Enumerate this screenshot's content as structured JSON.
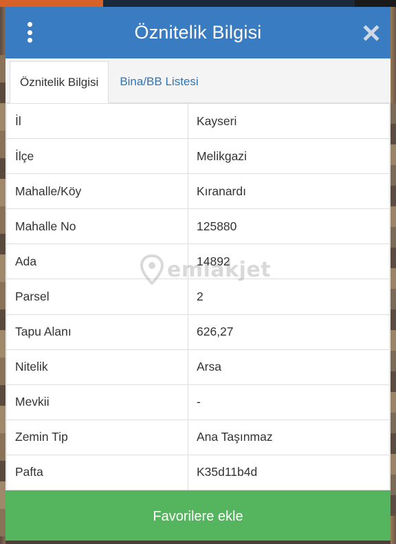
{
  "dialog": {
    "title": "Öznitelik Bilgisi",
    "tabs": [
      {
        "label": "Öznitelik Bilgisi",
        "active": true
      },
      {
        "label": "Bina/BB Listesi",
        "active": false
      }
    ],
    "rows": [
      {
        "key": "İl",
        "value": "Kayseri"
      },
      {
        "key": "İlçe",
        "value": "Melikgazi"
      },
      {
        "key": "Mahalle/Köy",
        "value": "Kıranardı"
      },
      {
        "key": "Mahalle No",
        "value": "125880"
      },
      {
        "key": "Ada",
        "value": "14892"
      },
      {
        "key": "Parsel",
        "value": "2"
      },
      {
        "key": "Tapu Alanı",
        "value": "626,27"
      },
      {
        "key": "Nitelik",
        "value": "Arsa"
      },
      {
        "key": "Mevkii",
        "value": "-"
      },
      {
        "key": "Zemin Tip",
        "value": "Ana Taşınmaz"
      },
      {
        "key": "Pafta",
        "value": "K35d11b4d"
      }
    ],
    "footer_button": "Favorilere ekle"
  },
  "watermark": {
    "text": "emlakjet"
  },
  "icons": {
    "menu": "vertical-dots-icon",
    "close": "close-icon",
    "watermark": "location-pin-icon"
  },
  "colors": {
    "header": "#3a7cc2",
    "tab_link": "#2f74b5",
    "footer": "#55b55e"
  }
}
